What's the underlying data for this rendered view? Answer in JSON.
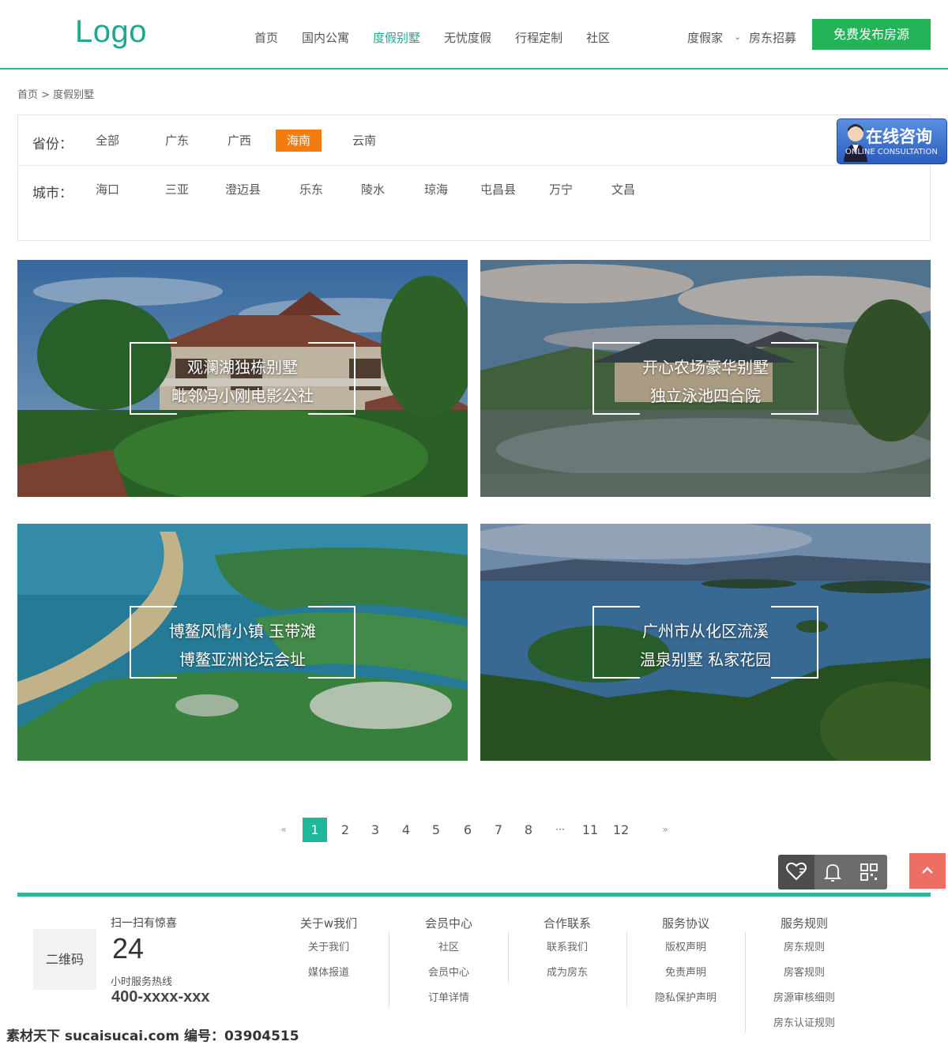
{
  "header": {
    "logo": "Logo",
    "nav": [
      {
        "label": "首页"
      },
      {
        "label": "国内公寓"
      },
      {
        "label": "度假别墅"
      },
      {
        "label": "无忧度假"
      },
      {
        "label": "行程定制"
      },
      {
        "label": "社区"
      }
    ],
    "active_nav": "度假别墅",
    "user_label": "度假家",
    "landlord_label": "房东招募",
    "publish_label": "免费发布房源",
    "accent_color": "#1fa88f",
    "publish_color": "#22b456"
  },
  "breadcrumb": "首页 > 度假别墅",
  "filter": {
    "province_label": "省份：",
    "provinces": [
      "全部",
      "广东",
      "广西",
      "海南",
      "云南"
    ],
    "selected_province": "海南",
    "city_label": "城市：",
    "cities": [
      "海口",
      "三亚",
      "澄迈县",
      "乐东",
      "陵水",
      "琼海",
      "屯昌县",
      "万宁",
      "文昌"
    ],
    "selected_color": "#f47c0f"
  },
  "consult": {
    "title": "在线咨询",
    "subtitle": "ONLINE CONSULTATION"
  },
  "cards": [
    {
      "line1": "观澜湖独栋别墅",
      "line2": "毗邻冯小刚电影公社"
    },
    {
      "line1": "开心农场豪华别墅",
      "line2": "独立泳池四合院"
    },
    {
      "line1": "博鳌风情小镇  玉带滩",
      "line2": "博鳌亚洲论坛会址"
    },
    {
      "line1": "广州市从化区流溪",
      "line2": "温泉别墅 私家花园"
    }
  ],
  "pagination": {
    "prev": "«",
    "pages": [
      "1",
      "2",
      "3",
      "4",
      "5",
      "6",
      "7",
      "8",
      "···",
      "11",
      "12"
    ],
    "current": "1",
    "next": "»"
  },
  "tools": {
    "icons": [
      "heart-chat-icon",
      "bell-icon",
      "qrcode-icon"
    ],
    "back_top_icon": "chevron-up-icon"
  },
  "footer": {
    "qr_label": "二维码",
    "scan_text": "扫一扫有惊喜",
    "hours": "24",
    "hotline_label": "小时服务热线",
    "hotline": "400-xxxx-xxx",
    "columns": [
      {
        "title": "关于w我们",
        "links": [
          "关于我们",
          "媒体报道"
        ]
      },
      {
        "title": "会员中心",
        "links": [
          "社区",
          "会员中心",
          "订单详情"
        ]
      },
      {
        "title": "合作联系",
        "links": [
          "联系我们",
          "成为房东"
        ]
      },
      {
        "title": "服务协议",
        "links": [
          "版权声明",
          "免责声明",
          "隐私保护声明"
        ]
      },
      {
        "title": "服务规则",
        "links": [
          "房东规则",
          "房客规则",
          "房源审核细则",
          "房东认证规则"
        ]
      }
    ],
    "line_color": "#2bb59a"
  },
  "watermark": "素材天下 sucaisucai.com  编号：03904515"
}
